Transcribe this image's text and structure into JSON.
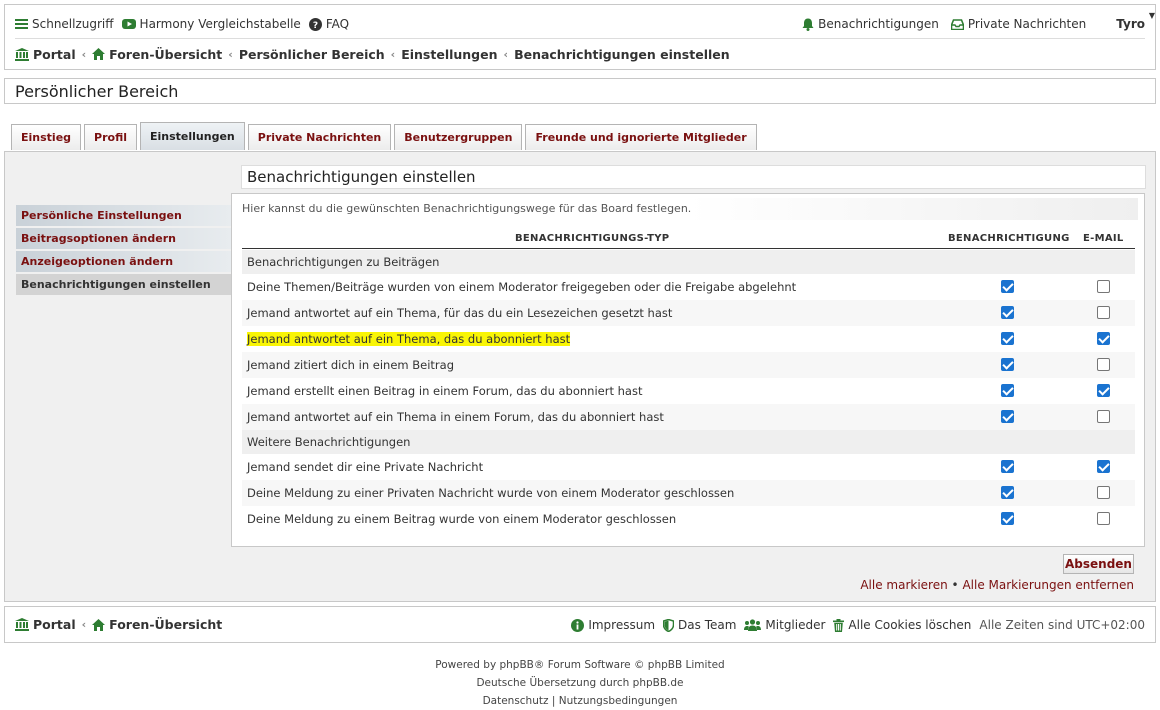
{
  "header": {
    "quicklinks": "Schnellzugriff",
    "harmony": "Harmony Vergleichstabelle",
    "faq": "FAQ",
    "notifications": "Benachrichtigungen",
    "private_messages": "Private Nachrichten",
    "username": "Tyro",
    "breadcrumbs": [
      "Portal",
      "Foren-Übersicht",
      "Persönlicher Bereich",
      "Einstellungen",
      "Benachrichtigungen einstellen"
    ]
  },
  "page_title": "Persönlicher Bereich",
  "tabs": [
    "Einstieg",
    "Profil",
    "Einstellungen",
    "Private Nachrichten",
    "Benutzergruppen",
    "Freunde und ignorierte Mitglieder"
  ],
  "active_tab": "Einstellungen",
  "sidemenu": [
    "Persönliche Einstellungen",
    "Beitragsoptionen ändern",
    "Anzeigeoptionen ändern",
    "Benachrichtigungen einstellen"
  ],
  "section_title": "Benachrichtigungen einstellen",
  "intro": "Hier kannst du die gewünschten Benachrichtigungswege für das Board festlegen.",
  "table": {
    "col_type": "BENACHRICHTIGUNGS-TYP",
    "col_notify": "BENACHRICHTIGUNG",
    "col_email": "E-MAIL"
  },
  "groups": [
    {
      "title": "Benachrichtigungen zu Beiträgen",
      "rows": [
        {
          "label": "Deine Themen/Beiträge wurden von einem Moderator freigegeben oder die Freigabe abgelehnt",
          "notify": true,
          "email": false
        },
        {
          "label": "Jemand antwortet auf ein Thema, für das du ein Lesezeichen gesetzt hast",
          "notify": true,
          "email": false
        },
        {
          "label": "Jemand antwortet auf ein Thema, das du abonniert hast",
          "notify": true,
          "email": true
        },
        {
          "label": "Jemand zitiert dich in einem Beitrag",
          "notify": true,
          "email": false
        },
        {
          "label": "Jemand erstellt einen Beitrag in einem Forum, das du abonniert hast",
          "notify": true,
          "email": true
        },
        {
          "label": "Jemand antwortet auf ein Thema in einem Forum, das du abonniert hast",
          "notify": true,
          "email": false
        }
      ]
    },
    {
      "title": "Weitere Benachrichtigungen",
      "rows": [
        {
          "label": "Jemand sendet dir eine Private Nachricht",
          "notify": true,
          "email": true
        },
        {
          "label": "Deine Meldung zu einer Privaten Nachricht wurde von einem Moderator geschlossen",
          "notify": true,
          "email": false
        },
        {
          "label": "Deine Meldung zu einem Beitrag wurde von einem Moderator geschlossen",
          "notify": true,
          "email": false
        }
      ]
    }
  ],
  "submit": "Absenden",
  "mark_all": "Alle markieren",
  "unmark_all": "Alle Markierungen entfernen",
  "footer": {
    "breadcrumbs": [
      "Portal",
      "Foren-Übersicht"
    ],
    "impressum": "Impressum",
    "team": "Das Team",
    "members": "Mitglieder",
    "delete_cookies": "Alle Cookies löschen",
    "timezone": "Alle Zeiten sind UTC+02:00"
  },
  "copyright": {
    "line1": "Powered by phpBB® Forum Software © phpBB Limited",
    "line2": "Deutsche Übersetzung durch phpBB.de",
    "privacy": "Datenschutz",
    "terms": "Nutzungsbedingungen"
  },
  "colors": {
    "accent": "#7a1010",
    "checkbox": "#1a73d0",
    "highlight": "#f9f505",
    "icon": "#2e7d32"
  }
}
